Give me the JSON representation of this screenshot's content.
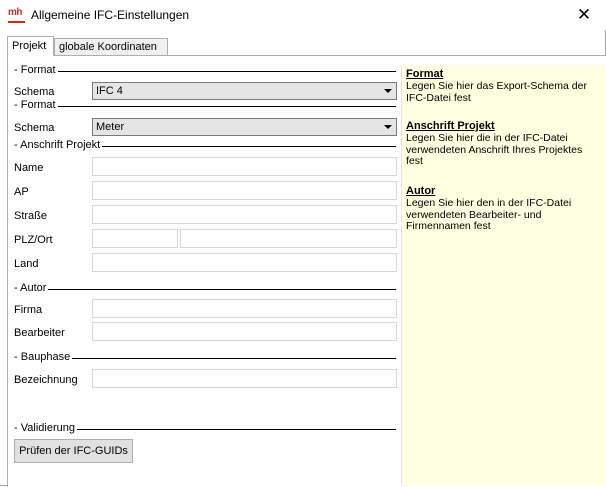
{
  "window": {
    "app_logo": "mh",
    "title": "Allgemeine IFC-Einstellungen",
    "close_glyph": "✕",
    "accent_color": "#d52b1e"
  },
  "tabs": [
    {
      "label": "Projekt",
      "active": true
    },
    {
      "label": "globale Koordinaten",
      "active": false
    }
  ],
  "format": {
    "group_title": "Format",
    "schema_label": "Schema",
    "schema_value": "IFC 4"
  },
  "format2": {
    "group_title": "Format",
    "schema_label": "Schema",
    "schema_value": "Meter"
  },
  "anschrift": {
    "group_title": "Anschrift Projekt",
    "name_label": "Name",
    "ap_label": "AP",
    "strasse_label": "Straße",
    "plz_ort_label": "PLZ/Ort",
    "land_label": "Land",
    "name_value": "",
    "ap_value": "",
    "strasse_value": "",
    "plz_value": "",
    "ort_value": "",
    "land_value": ""
  },
  "autor": {
    "group_title": "Autor",
    "firma_label": "Firma",
    "bearbeiter_label": "Bearbeiter",
    "firma_value": "",
    "bearbeiter_value": ""
  },
  "bauphase": {
    "group_title": "Bauphase",
    "bezeichnung_label": "Bezeichnung",
    "bezeichnung_value": ""
  },
  "validierung": {
    "group_title": "Validierung",
    "button_label": "Prüfen der IFC-GUIDs"
  },
  "help": {
    "sections": [
      {
        "heading": "Format",
        "text": "Legen Sie hier das Export-Schema der IFC-Datei fest"
      },
      {
        "heading": "Anschrift Projekt",
        "text": "Legen Sie hier die in der IFC-Datei verwendeten Anschrift Ihres Projektes fest"
      },
      {
        "heading": "Autor",
        "text": "Legen Sie hier den in der IFC-Datei verwendeten Bearbeiter- und Firmennamen fest"
      }
    ]
  }
}
